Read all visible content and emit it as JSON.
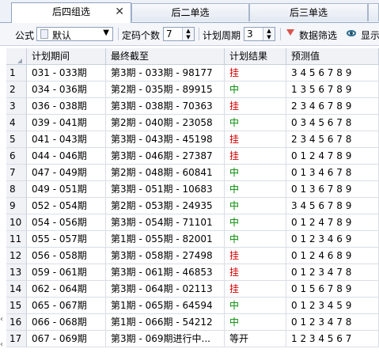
{
  "tabs": [
    {
      "label": "后四组选",
      "active": true
    },
    {
      "label": "后二单选",
      "active": false
    },
    {
      "label": "后三单选",
      "active": false
    }
  ],
  "toolbar": {
    "formula_label": "公式",
    "formula_value": "默认",
    "count_label": "定码个数",
    "count_value": "7",
    "period_label": "计划周期",
    "period_value": "3",
    "filter_label": "数据筛选",
    "show_label": "显示"
  },
  "table": {
    "headers": [
      "计划期间",
      "最终截至",
      "计划结果",
      "预测值"
    ],
    "rows": [
      {
        "n": "1",
        "period": "031 - 033期",
        "last": "第3期 - 033期 - 98177",
        "result": "挂",
        "pred": "3 4 5 6 7 8 9"
      },
      {
        "n": "2",
        "period": "034 - 036期",
        "last": "第2期 - 035期 - 89915",
        "result": "中",
        "pred": "1 3 5 6 7 8 9"
      },
      {
        "n": "3",
        "period": "036 - 038期",
        "last": "第3期 - 038期 - 70363",
        "result": "挂",
        "pred": "2 3 4 6 7 8 9"
      },
      {
        "n": "4",
        "period": "039 - 041期",
        "last": "第2期 - 040期 - 23058",
        "result": "中",
        "pred": "0 3 4 5 6 7 8"
      },
      {
        "n": "5",
        "period": "041 - 043期",
        "last": "第3期 - 043期 - 45198",
        "result": "挂",
        "pred": "2 3 4 5 6 7 8"
      },
      {
        "n": "6",
        "period": "044 - 046期",
        "last": "第3期 - 046期 - 27387",
        "result": "挂",
        "pred": "0 1 2 4 7 8 9"
      },
      {
        "n": "7",
        "period": "047 - 049期",
        "last": "第2期 - 048期 - 60841",
        "result": "中",
        "pred": "0 1 3 4 6 7 8"
      },
      {
        "n": "8",
        "period": "049 - 051期",
        "last": "第3期 - 051期 - 10683",
        "result": "中",
        "pred": "0 1 3 6 7 8 9"
      },
      {
        "n": "9",
        "period": "052 - 054期",
        "last": "第2期 - 053期 - 24935",
        "result": "中",
        "pred": "3 4 5 6 7 8 9"
      },
      {
        "n": "10",
        "period": "054 - 056期",
        "last": "第3期 - 054期 - 71101",
        "result": "中",
        "pred": "0 1 2 4 7 8 9"
      },
      {
        "n": "11",
        "period": "055 - 057期",
        "last": "第1期 - 055期 - 82001",
        "result": "中",
        "pred": "0 1 2 3 4 6 9"
      },
      {
        "n": "12",
        "period": "056 - 058期",
        "last": "第3期 - 058期 - 27498",
        "result": "挂",
        "pred": "0 1 2 4 6 8 9"
      },
      {
        "n": "13",
        "period": "059 - 061期",
        "last": "第3期 - 061期 - 46853",
        "result": "挂",
        "pred": "0 1 2 3 4 7 8"
      },
      {
        "n": "14",
        "period": "062 - 064期",
        "last": "第3期 - 064期 - 02113",
        "result": "挂",
        "pred": "0 1 5 6 7 8 9"
      },
      {
        "n": "15",
        "period": "065 - 067期",
        "last": "第1期 - 065期 - 64594",
        "result": "中",
        "pred": "0 1 2 3 4 5 9"
      },
      {
        "n": "16",
        "period": "066 - 068期",
        "last": "第1期 - 066期 - 54212",
        "result": "中",
        "pred": "0 1 2 3 4 7 8"
      },
      {
        "n": "17",
        "period": "067 - 069期",
        "last": "第3期 - 069期进行中...",
        "result": "等开",
        "pred": "1 2 3 4 5 6 7"
      }
    ]
  },
  "colors": {
    "hit": "#008a00",
    "miss": "#d40000"
  }
}
